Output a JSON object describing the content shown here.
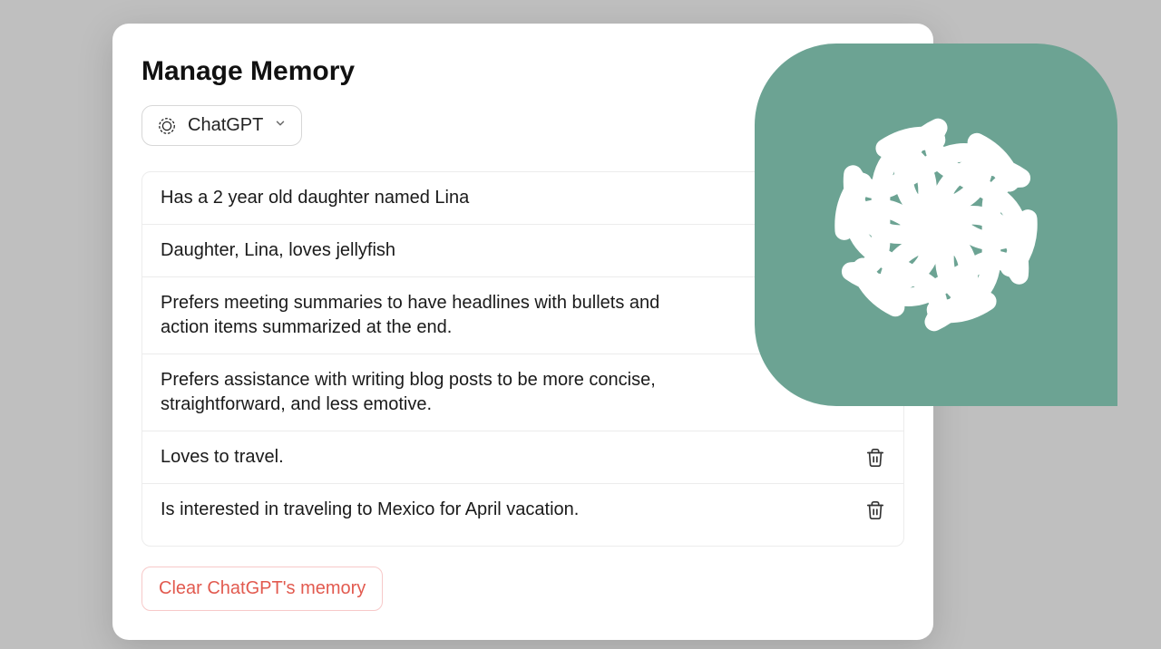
{
  "title": "Manage Memory",
  "selector": {
    "label": "ChatGPT"
  },
  "memories": [
    {
      "text": "Has a 2 year old daughter named Lina",
      "trashVisible": false
    },
    {
      "text": "Daughter, Lina, loves jellyfish",
      "trashVisible": false
    },
    {
      "text": "Prefers meeting summaries to have headlines with bullets and action items summarized at the end.",
      "trashVisible": false
    },
    {
      "text": "Prefers assistance with writing blog posts to be more concise, straightforward, and less emotive.",
      "trashVisible": false
    },
    {
      "text": "Loves to travel.",
      "trashVisible": true
    },
    {
      "text": "Is interested in traveling to Mexico for April vacation.",
      "trashVisible": true
    }
  ],
  "clearLabel": "Clear ChatGPT's memory",
  "colors": {
    "logoBg": "#6ca393",
    "clearText": "#e25a4f"
  }
}
